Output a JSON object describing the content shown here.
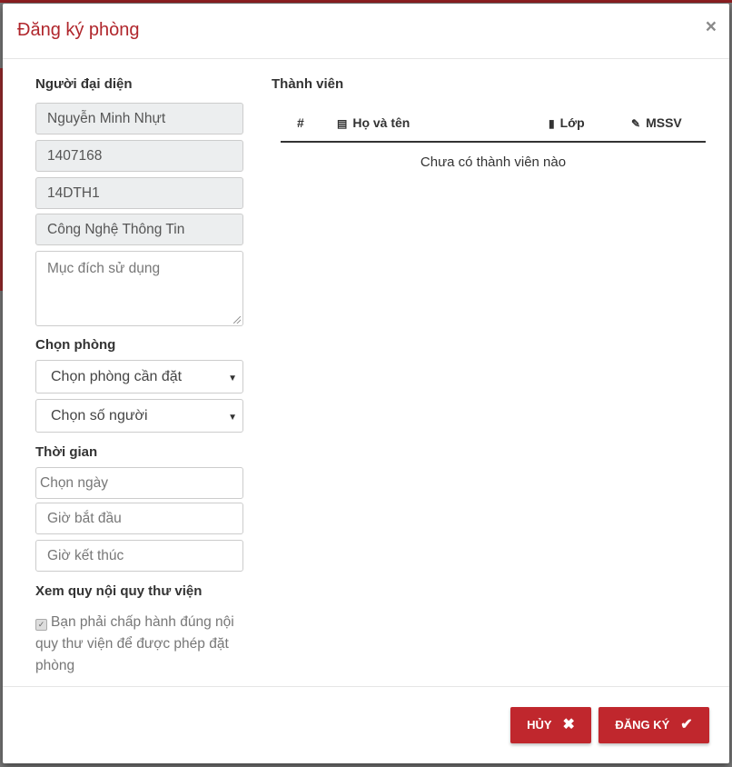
{
  "modal": {
    "title": "Đăng ký phòng",
    "close_label": "×"
  },
  "representative": {
    "label": "Người đại diện",
    "name": "Nguyễn Minh Nhựt",
    "student_id": "1407168",
    "class": "14DTH1",
    "faculty": "Công Nghệ Thông Tin",
    "purpose_placeholder": "Mục đích sử dụng"
  },
  "room": {
    "label": "Chọn phòng",
    "room_select": "Chọn phòng cần đặt",
    "people_select": "Chọn số người"
  },
  "time": {
    "label": "Thời gian",
    "date_placeholder": "Chọn ngày",
    "start_placeholder": "Giờ bắt đầu",
    "end_placeholder": "Giờ kết thúc"
  },
  "rules": {
    "label": "Xem quy nội quy thư viện",
    "agreement": "Bạn phải chấp hành đúng nội quy thư viện để được phép đặt phòng",
    "checked": true
  },
  "members": {
    "title": "Thành viên",
    "columns": [
      "#",
      "Họ và tên",
      "Lớp",
      "MSSV"
    ],
    "column_icons": [
      "",
      "id-card-icon",
      "door-icon",
      "paperclip-icon"
    ],
    "empty_text": "Chưa có thành viên nào"
  },
  "footer": {
    "cancel_label": "HỦY",
    "submit_label": "ĐĂNG KÝ"
  },
  "colors": {
    "accent": "#c0272d",
    "title": "#b0262c"
  }
}
